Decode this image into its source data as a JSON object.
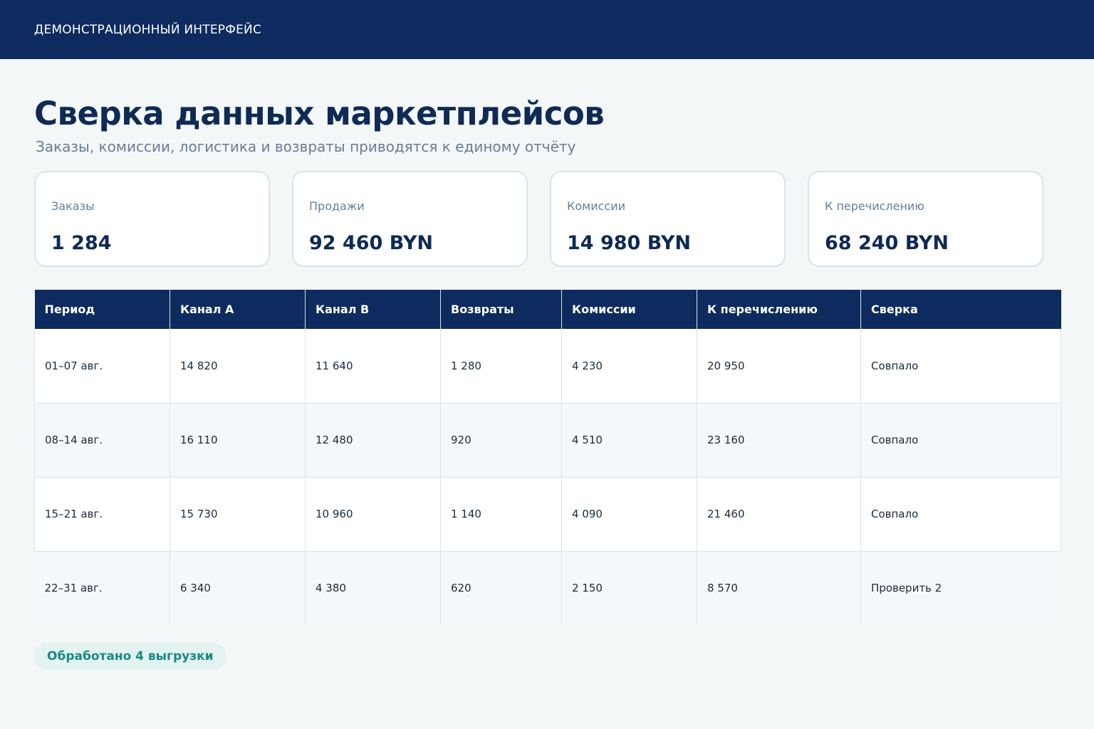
{
  "header": {
    "brand": "ДЕМОНСТРАЦИОННЫЙ ИНТЕРФЕЙС"
  },
  "page": {
    "title": "Сверка данных маркетплейсов",
    "subtitle": "Заказы, комиссии, логистика и возвраты приводятся к единому отчёту"
  },
  "cards": [
    {
      "label": "Заказы",
      "value": "1 284"
    },
    {
      "label": "Продажи",
      "value": "92 460 BYN"
    },
    {
      "label": "Комиссии",
      "value": "14 980 BYN"
    },
    {
      "label": "К перечислению",
      "value": "68 240 BYN"
    }
  ],
  "table": {
    "columns": [
      "Период",
      "Канал A",
      "Канал B",
      "Возвраты",
      "Комиссии",
      "К перечислению",
      "Сверка"
    ],
    "rows": [
      [
        "01–07 авг.",
        "14 820",
        "11 640",
        "1 280",
        "4 230",
        "20 950",
        "Совпало"
      ],
      [
        "08–14 авг.",
        "16 110",
        "12 480",
        "920",
        "4 510",
        "23 160",
        "Совпало"
      ],
      [
        "15–21 авг.",
        "15 730",
        "10 960",
        "1 140",
        "4 090",
        "21 460",
        "Совпало"
      ],
      [
        "22–31 авг.",
        "6 340",
        "4 380",
        "620",
        "2 150",
        "8 570",
        "Проверить 2"
      ]
    ]
  },
  "footer": {
    "status": "Обработано 4 выгрузки"
  },
  "colors": {
    "header_bg": "#0d2b5e",
    "page_bg": "#f3f7f8",
    "accent_text": "#0e2a55",
    "status_bg": "#e2f3f1",
    "status_text": "#1a8a7e"
  }
}
